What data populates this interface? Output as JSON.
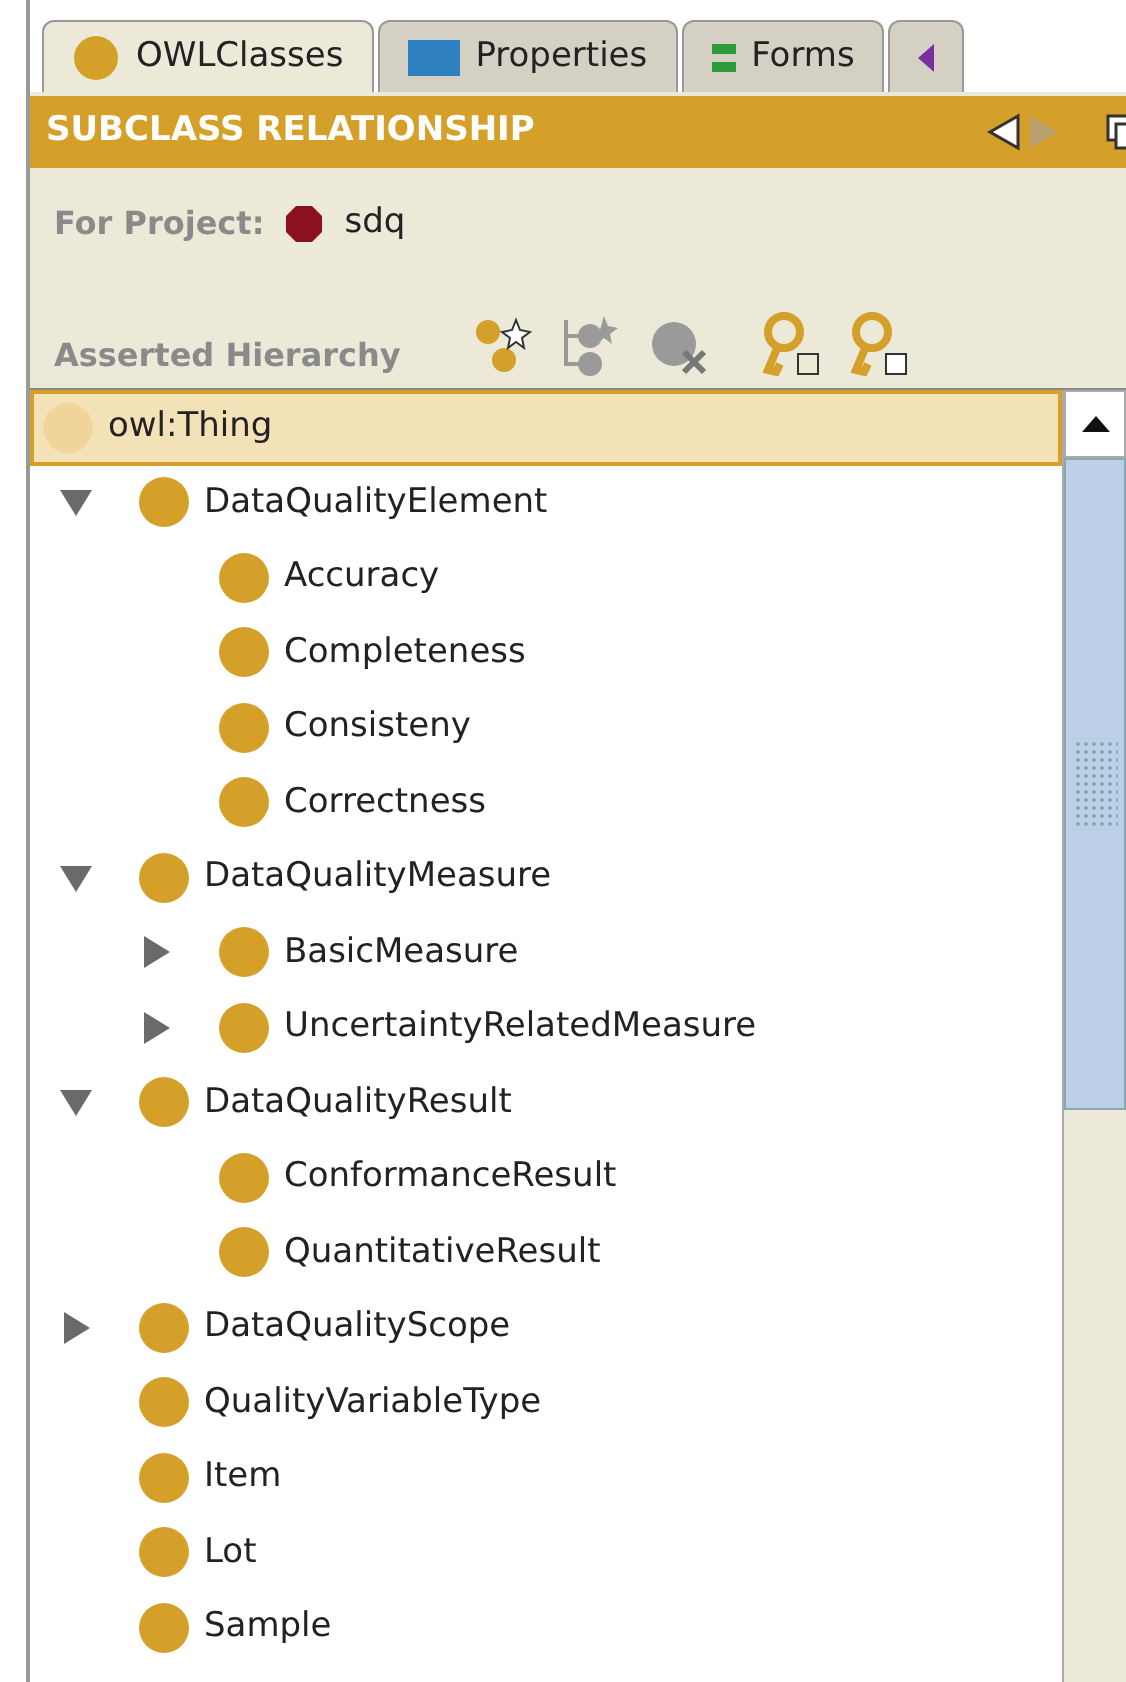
{
  "tabs": [
    {
      "label": "OWLClasses",
      "kind": "class",
      "selected": true
    },
    {
      "label": "Properties",
      "kind": "property",
      "selected": false
    },
    {
      "label": "Forms",
      "kind": "form",
      "selected": false
    },
    {
      "kind": "individual",
      "selected": false
    }
  ],
  "header": {
    "title": "SUBCLASS RELATIONSHIP",
    "nav": [
      {
        "kind": "back",
        "disabled": false
      },
      {
        "kind": "forward",
        "disabled": true
      }
    ]
  },
  "project": {
    "label": "For Project:",
    "name": "sdq"
  },
  "hierarchy": {
    "title": "Asserted Hierarchy",
    "tools": [
      {
        "kind": "create-class",
        "disabled": false
      },
      {
        "kind": "create-subclass",
        "disabled": true
      },
      {
        "kind": "delete-class",
        "disabled": true
      },
      {
        "kind": "key-e",
        "disabled": false
      },
      {
        "kind": "key-c",
        "disabled": false
      }
    ]
  },
  "tree": {
    "label": "owl:Thing",
    "selected": true,
    "children": [
      {
        "label": "DataQualityElement",
        "selected": false,
        "expanded": true,
        "children": [
          {
            "label": "Accuracy",
            "selected": false
          },
          {
            "label": "Completeness",
            "selected": false
          },
          {
            "label": "Consisteny",
            "selected": false
          },
          {
            "label": "Correctness",
            "selected": false
          }
        ]
      },
      {
        "label": "DataQualityMeasure",
        "selected": false,
        "expanded": true,
        "children": [
          {
            "label": "BasicMeasure",
            "selected": false,
            "expanded": false
          },
          {
            "label": "UncertaintyRelatedMeasure",
            "selected": false,
            "expanded": false
          }
        ]
      },
      {
        "label": "DataQualityResult",
        "selected": false,
        "expanded": true,
        "children": [
          {
            "label": "ConformanceResult",
            "selected": false
          },
          {
            "label": "QuantitativeResult",
            "selected": false
          }
        ]
      },
      {
        "label": "DataQualityScope",
        "selected": false,
        "expanded": false
      },
      {
        "label": "QualityVariableType",
        "selected": false
      },
      {
        "label": "Item",
        "selected": false
      },
      {
        "label": "Lot",
        "selected": false
      },
      {
        "label": "Sample",
        "selected": false
      }
    ]
  }
}
